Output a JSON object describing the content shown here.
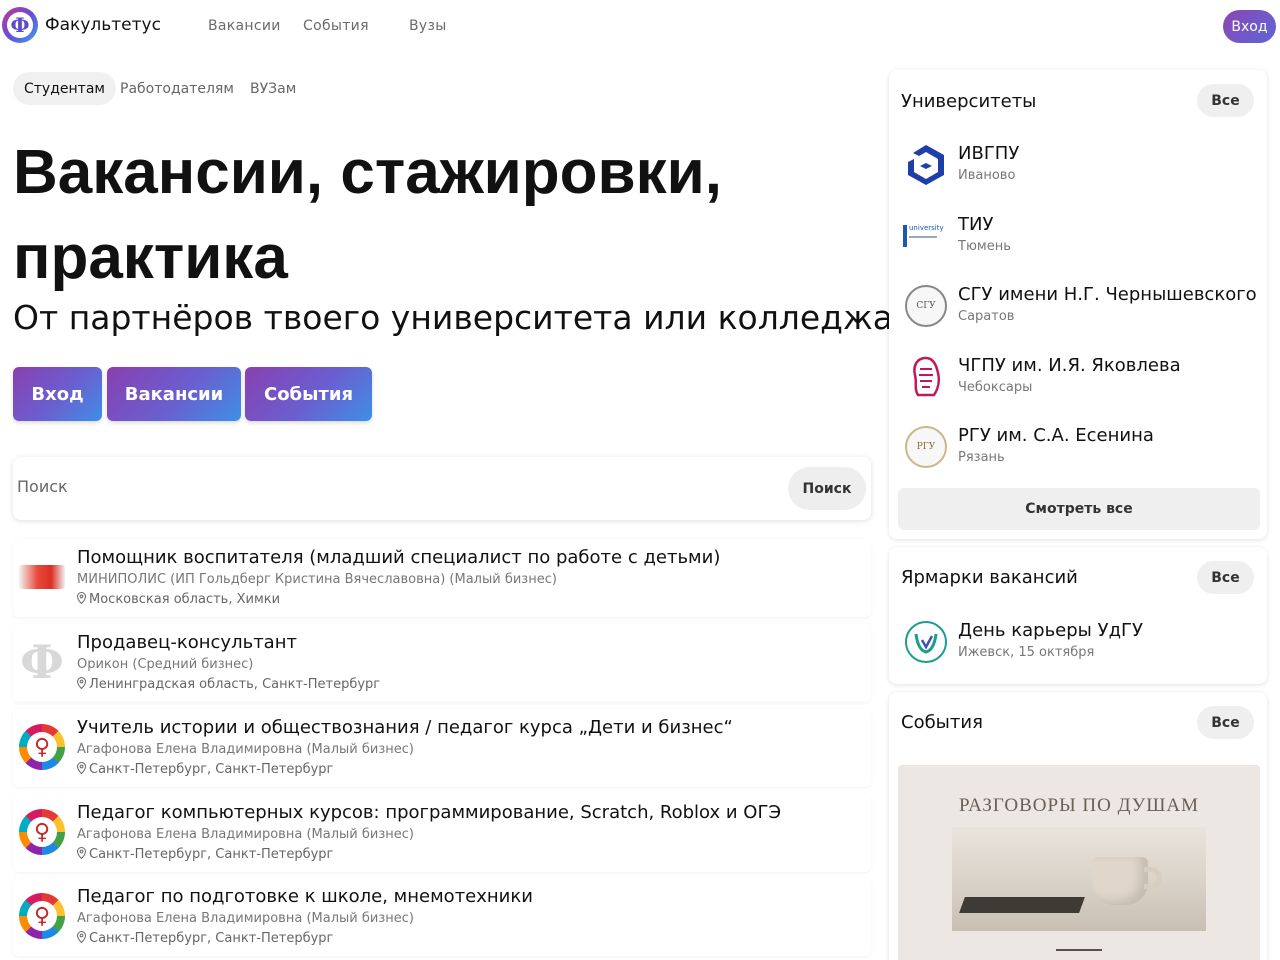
{
  "header": {
    "brand": "Факультетус",
    "logo_glyph": "Ф",
    "nav": [
      "Вакансии",
      "События",
      "Вузы"
    ],
    "login": "Вход"
  },
  "audience_tabs": [
    {
      "label": "Студентам",
      "active": true
    },
    {
      "label": "Работодателям",
      "active": false
    },
    {
      "label": "ВУЗам",
      "active": false
    }
  ],
  "hero": {
    "title": "Вакансии, стажировки, практика",
    "subtitle": "От партнёров твоего университета или колледжа",
    "buttons": [
      "Вход",
      "Вакансии",
      "События"
    ]
  },
  "search": {
    "placeholder": "Поиск",
    "button": "Поиск"
  },
  "vacancies": [
    {
      "title": "Помощник воспитателя (младший специалист по работе с детьми)",
      "company": "МИНИПОЛИС (ИП Гольдберг Кристина Вячеславовна) (Малый бизнес)",
      "location": "Московская область, Химки",
      "logo": "minipolis-logo"
    },
    {
      "title": "Продавец-консультант",
      "company": "Орикон (Средний бизнес)",
      "location": "Ленинградская область, Санкт-Петербург",
      "logo": "placeholder-phi-logo"
    },
    {
      "title": "Учитель истории и обществознания / педагог курса „Дети и бизнес“",
      "company": "Агафонова Елена Владимировна (Малый бизнес)",
      "location": "Санкт-Петербург, Санкт-Петербург",
      "logo": "mosaic-logo"
    },
    {
      "title": "Педагог компьютерных курсов: программирование, Scratch, Roblox и ОГЭ",
      "company": "Агафонова Елена Владимировна (Малый бизнес)",
      "location": "Санкт-Петербург, Санкт-Петербург",
      "logo": "mosaic-logo"
    },
    {
      "title": "Педагог по подготовке к школе, мнемотехники",
      "company": "Агафонова Елена Владимировна (Малый бизнес)",
      "location": "Санкт-Петербург, Санкт-Петербург",
      "logo": "mosaic-logo"
    }
  ],
  "universities": {
    "title": "Университеты",
    "all": "Все",
    "see_all": "Смотреть все",
    "items": [
      {
        "name": "ИВГПУ",
        "city": "Иваново",
        "logo": "ivgpu-logo"
      },
      {
        "name": "ТИУ",
        "city": "Тюмень",
        "logo": "tiu-logo",
        "logo_text": "university"
      },
      {
        "name": "СГУ имени Н.Г. Чернышевского",
        "city": "Саратов",
        "logo": "sgu-logo",
        "logo_text": "СГУ"
      },
      {
        "name": "ЧГПУ им. И.Я. Яковлева",
        "city": "Чебоксары",
        "logo": "chgpu-logo"
      },
      {
        "name": "РГУ им. С.А. Есенина",
        "city": "Рязань",
        "logo": "rgu-logo",
        "logo_text": "РГУ"
      }
    ]
  },
  "fairs": {
    "title": "Ярмарки вакансий",
    "all": "Все",
    "items": [
      {
        "name": "День карьеры УдГУ",
        "meta": "Ижевск, 15 октября",
        "logo": "udgu-logo"
      }
    ]
  },
  "events": {
    "title": "События",
    "all": "Все",
    "banner_text": "РАЗГОВОРЫ ПО ДУШАМ"
  },
  "colors": {
    "accent_start": "#8a3fb0",
    "accent_end": "#3e8fe6"
  }
}
